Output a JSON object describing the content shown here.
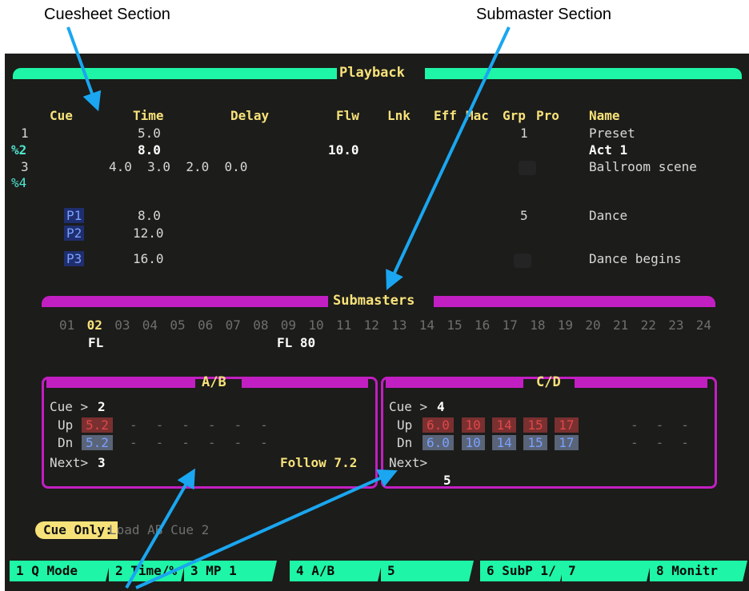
{
  "annotations": {
    "cuesheet": "Cuesheet Section",
    "submaster": "Submaster Section"
  },
  "playback": {
    "title": "Playback",
    "headers": {
      "cue": "Cue",
      "time": "Time",
      "delay": "Delay",
      "flw": "Flw",
      "lnk": "Lnk",
      "eff": "Eff",
      "mac": "Mac",
      "grp": "Grp",
      "pro": "Pro",
      "name": "Name"
    },
    "rows": [
      {
        "cue": "1",
        "time": "5.0",
        "grp": "1",
        "name": "Preset"
      },
      {
        "cue": "%2",
        "time": "8.0",
        "flw": "10.0",
        "name": "Act 1"
      },
      {
        "cue": "3",
        "time_split": "4.0  3.0  2.0  0.0",
        "name": "Ballroom scene"
      },
      {
        "cue": "%4"
      },
      {
        "part": "P1",
        "time": "8.0",
        "grp": "5",
        "name": "Dance"
      },
      {
        "part": "P2",
        "time": "12.0"
      },
      {
        "part": "P3",
        "time": "16.0",
        "name": "Dance begins"
      }
    ]
  },
  "submasters": {
    "title": "Submasters",
    "numbers": [
      "01",
      "02",
      "03",
      "04",
      "05",
      "06",
      "07",
      "08",
      "09",
      "10",
      "11",
      "12",
      "13",
      "14",
      "15",
      "16",
      "17",
      "18",
      "19",
      "20",
      "21",
      "22",
      "23",
      "24"
    ],
    "active_index": 1,
    "label_02": "FL",
    "label_10": "FL 80"
  },
  "ab": {
    "title": "A/B",
    "cue_label": "Cue >",
    "cue": "2",
    "up_label": "Up",
    "up": [
      "5.2"
    ],
    "dn_label": "Dn",
    "dn": [
      "5.2"
    ],
    "next_label": "Next>",
    "next": "3",
    "follow": "Follow 7.2"
  },
  "cd": {
    "title": "C/D",
    "cue_label": "Cue >",
    "cue": "4",
    "up_label": "Up",
    "up": [
      "6.0",
      "10",
      "14",
      "15",
      "17"
    ],
    "dn_label": "Dn",
    "dn": [
      "6.0",
      "10",
      "14",
      "15",
      "17"
    ],
    "next_label": "Next>",
    "next_below": "5"
  },
  "command_line": {
    "mode": "Cue Only:",
    "text": "Load AB Cue 2"
  },
  "softkeys": [
    "1 Q Mode",
    "2 Time/%",
    "3 MP 1",
    "4 A/B",
    "5",
    "6 SubP 1/",
    "7",
    "8 Monitr"
  ],
  "colors": {
    "accent_green": "#1ef5a6",
    "accent_magenta": "#c21fc2",
    "arrow_blue": "#1aa6f0",
    "header_yellow": "#f7e27a"
  }
}
